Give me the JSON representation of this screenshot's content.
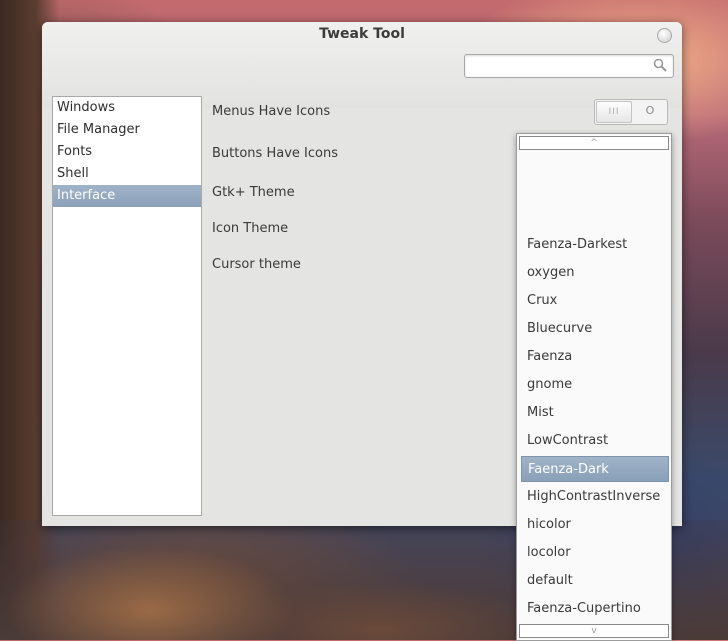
{
  "window": {
    "title": "Tweak Tool"
  },
  "search": {
    "value": "",
    "placeholder": ""
  },
  "sidebar": {
    "items": [
      {
        "label": "Windows"
      },
      {
        "label": "File Manager"
      },
      {
        "label": "Fonts"
      },
      {
        "label": "Shell"
      },
      {
        "label": "Interface",
        "selected": true
      }
    ]
  },
  "settings": {
    "menus_have_icons": "Menus Have Icons",
    "buttons_have_icons": "Buttons Have Icons",
    "gtk_theme": "Gtk+ Theme",
    "icon_theme": "Icon Theme",
    "cursor_theme": "Cursor theme"
  },
  "toggle": {
    "state": "off",
    "on_glyph": "III",
    "off_glyph": "O"
  },
  "icon_theme_dropdown": {
    "scroll_up_glyph": "^",
    "scroll_down_glyph": "v",
    "selected": "Faenza-Dark",
    "options": [
      "Faenza-Darkest",
      "oxygen",
      "Crux",
      "Bluecurve",
      "Faenza",
      "gnome",
      "Mist",
      "LowContrast",
      "Faenza-Dark",
      "HighContrastInverse",
      "hicolor",
      "locolor",
      "default",
      "Faenza-Cupertino"
    ]
  },
  "colors": {
    "selection": "#9fb3c8",
    "window_bg": "#e4e4e2"
  }
}
